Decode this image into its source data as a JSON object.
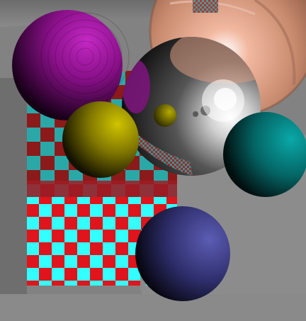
{
  "scene": {
    "type": "ray-traced render",
    "background_color": "#828282",
    "floor_checker_colors": [
      "#e0141c",
      "#33ffff"
    ],
    "reflected_checker_colors": [
      "#8c1a1a",
      "#2aa8a8"
    ],
    "sphere_colors": {
      "magenta": "#b020b0",
      "olive": "#c8c000",
      "chrome": "#ffffff",
      "teal": "#00b0b0",
      "navy": "#5a5ab0",
      "copper": "#f0a888"
    }
  }
}
